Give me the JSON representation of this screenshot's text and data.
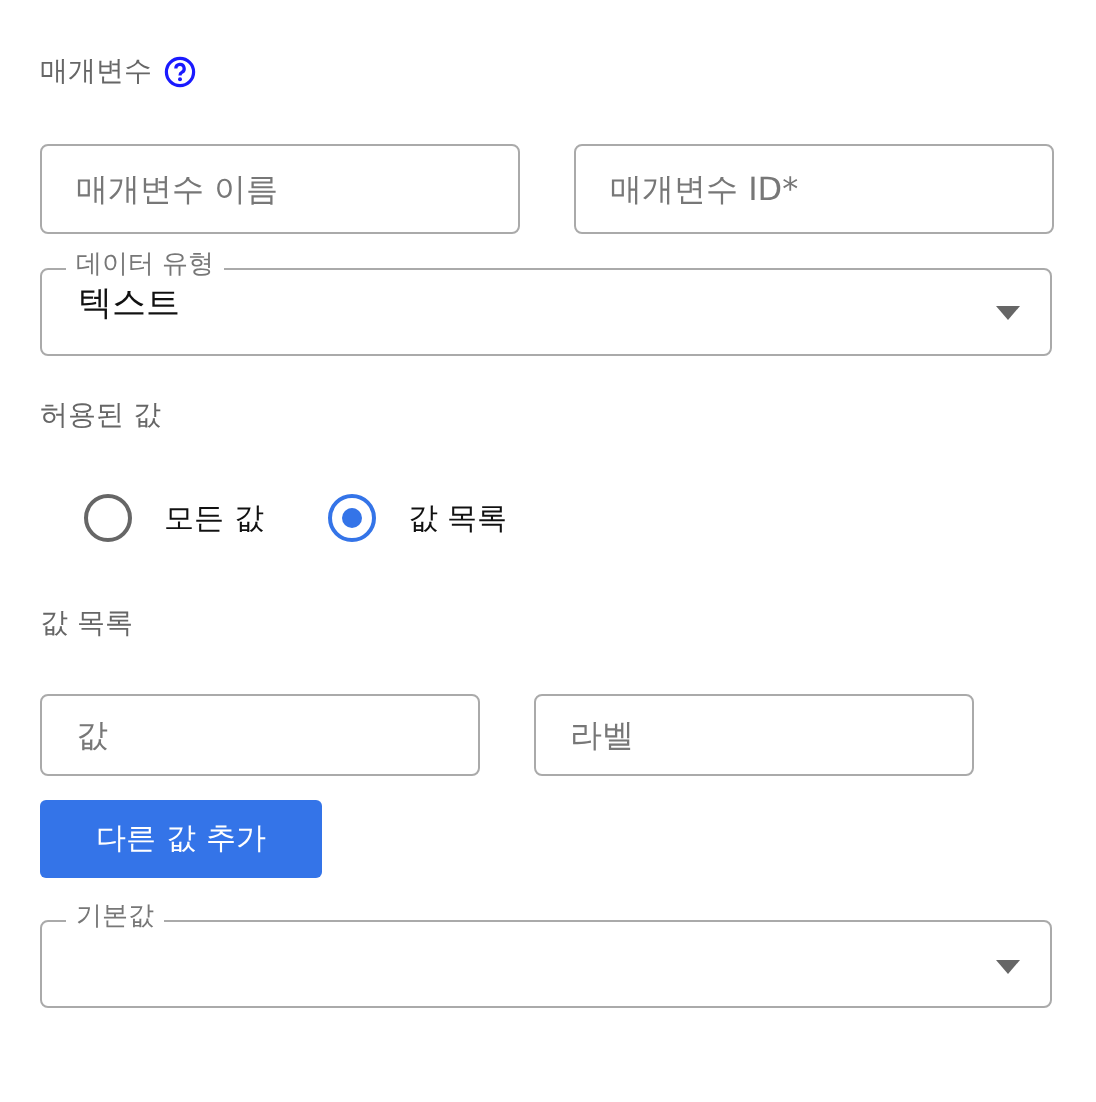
{
  "section": {
    "title": "매개변수"
  },
  "fields": [
    {
      "placeholder": "매개변수 이름"
    },
    {
      "placeholder": "매개변수 ID*"
    }
  ],
  "data_type": {
    "label": "데이터 유형",
    "value": "텍스트"
  },
  "allowed_values": {
    "label": "허용된 값",
    "options": [
      {
        "label": "모든 값",
        "selected": false
      },
      {
        "label": "값 목록",
        "selected": true
      }
    ]
  },
  "value_list": {
    "label": "값 목록",
    "fields": [
      {
        "placeholder": "값"
      },
      {
        "placeholder": "라벨"
      }
    ],
    "add_button": "다른 값 추가"
  },
  "default_value": {
    "label": "기본값"
  }
}
